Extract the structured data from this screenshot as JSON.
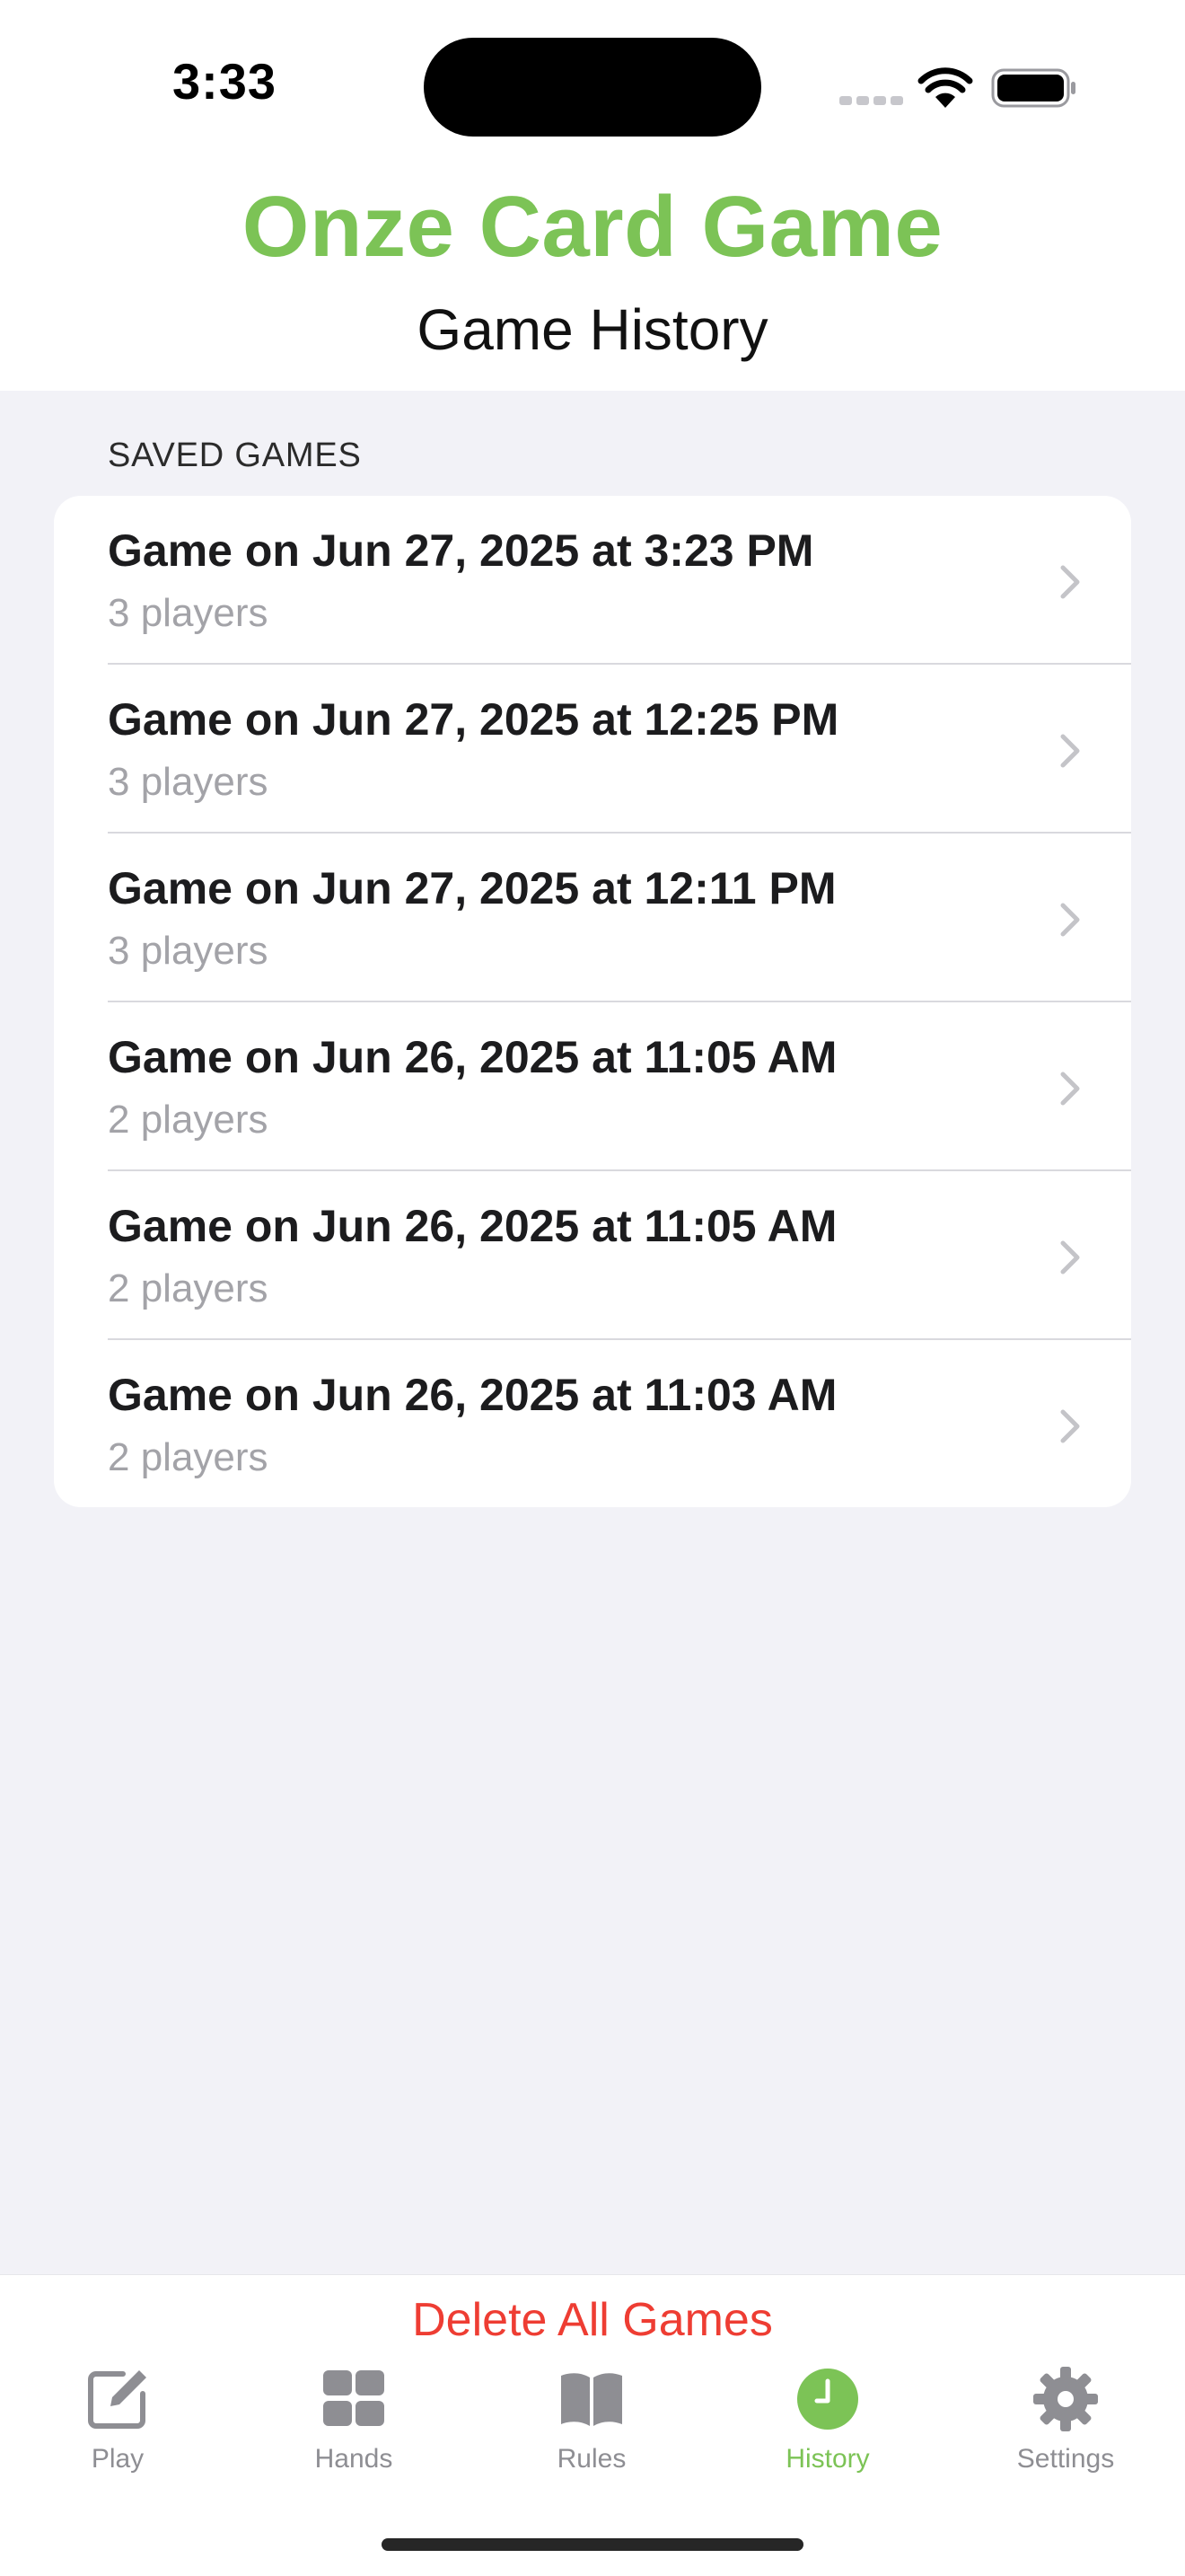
{
  "status_bar": {
    "time": "3:33"
  },
  "header": {
    "app_title": "Onze Card Game",
    "screen_title": "Game History"
  },
  "list": {
    "section_header": "SAVED GAMES",
    "games": [
      {
        "title": "Game on Jun 27, 2025 at 3:23 PM",
        "subtitle": "3 players"
      },
      {
        "title": "Game on Jun 27, 2025 at 12:25 PM",
        "subtitle": "3 players"
      },
      {
        "title": "Game on Jun 27, 2025 at 12:11 PM",
        "subtitle": "3 players"
      },
      {
        "title": "Game on Jun 26, 2025 at 11:05 AM",
        "subtitle": "2 players"
      },
      {
        "title": "Game on Jun 26, 2025 at 11:05 AM",
        "subtitle": "2 players"
      },
      {
        "title": "Game on Jun 26, 2025 at 11:03 AM",
        "subtitle": "2 players"
      }
    ]
  },
  "actions": {
    "delete_all_label": "Delete All Games"
  },
  "tabs": [
    {
      "label": "Play",
      "icon": "square-pencil-icon",
      "active": false
    },
    {
      "label": "Hands",
      "icon": "grid-icon",
      "active": false
    },
    {
      "label": "Rules",
      "icon": "book-icon",
      "active": false
    },
    {
      "label": "History",
      "icon": "clock-icon",
      "active": true
    },
    {
      "label": "Settings",
      "icon": "gear-icon",
      "active": false
    }
  ],
  "colors": {
    "accent": "#7cc356",
    "destructive": "#ee3d33",
    "inactive_tab": "#8e8e93",
    "background": "#f2f2f7"
  }
}
